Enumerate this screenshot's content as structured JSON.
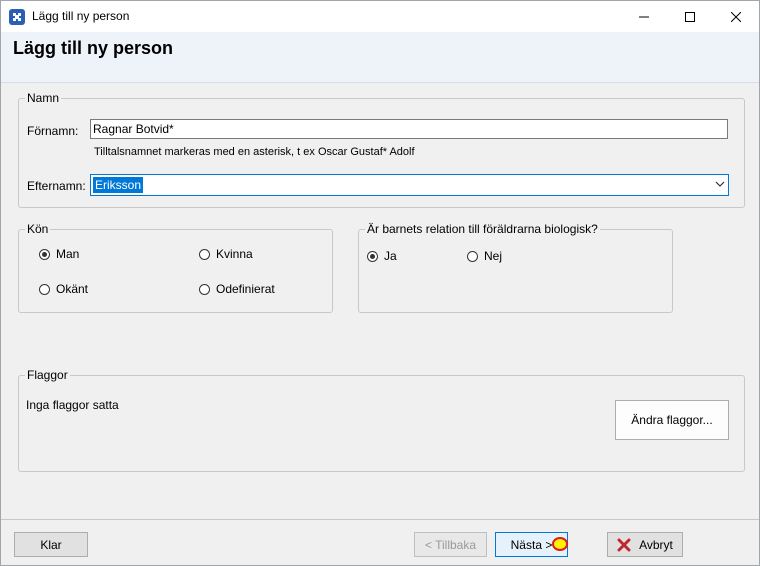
{
  "window": {
    "title": "Lägg till ny person"
  },
  "header": {
    "title": "Lägg till ny person"
  },
  "name_group": {
    "legend": "Namn",
    "first_name_label": "Förnamn:",
    "first_name_value": "Ragnar Botvid*",
    "hint": "Tilltalsnamnet markeras med en asterisk, t ex  Oscar Gustaf* Adolf",
    "last_name_label": "Efternamn:",
    "last_name_value": "Eriksson"
  },
  "gender_group": {
    "legend": "Kön",
    "options": [
      {
        "label": "Man",
        "selected": true
      },
      {
        "label": "Kvinna",
        "selected": false
      },
      {
        "label": "Okänt",
        "selected": false
      },
      {
        "label": "Odefinierat",
        "selected": false
      }
    ]
  },
  "relation_group": {
    "legend": "Är barnets relation till föräldrarna biologisk?",
    "options": [
      {
        "label": "Ja",
        "selected": true
      },
      {
        "label": "Nej",
        "selected": false
      }
    ]
  },
  "flags_group": {
    "legend": "Flaggor",
    "status": "Inga flaggor satta",
    "change_button": "Ändra flaggor..."
  },
  "footer": {
    "clear": "Klar",
    "back": "< Tillbaka",
    "next": "Nästa >",
    "cancel": "Avbryt"
  },
  "colors": {
    "accent": "#0078d7",
    "cancel_icon": "#c0282d",
    "header_bg": "#eef2f9"
  }
}
